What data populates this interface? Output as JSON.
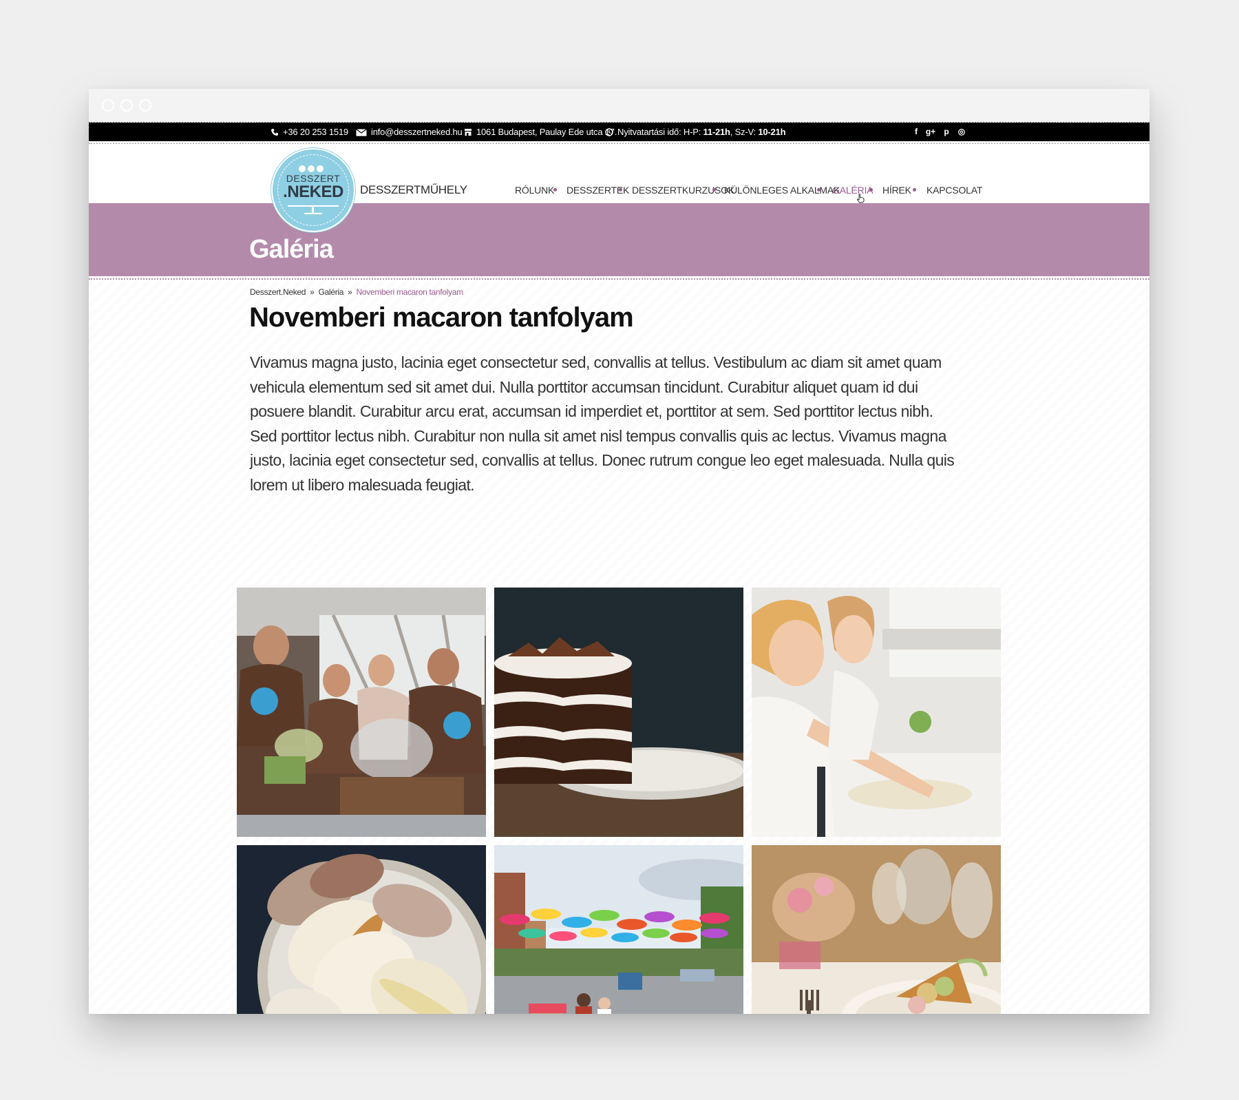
{
  "topbar": {
    "phone": "+36 20 253 1519",
    "email": "info@desszertneked.hu",
    "address": "1061 Budapest, Paulay Ede utca 17.",
    "hours_label": "Nyitvatartási idő: H-P: ",
    "hours_weekday": "11-21h",
    "hours_sep": ", Sz-V: ",
    "hours_weekend": "10-21h",
    "social": [
      "f",
      "g+",
      "p",
      "◎"
    ]
  },
  "logo": {
    "line1": "DESSZERT",
    "line2": ".NEKED"
  },
  "tagline": "DESSZERTMŰHELY",
  "nav": [
    "RÓLUNK",
    "DESSZERTEK",
    "DESSZERTKURZUSOK",
    "KÜLÖNLEGES ALKALMAK",
    "GALÉRIA",
    "HÍREK",
    "KAPCSOLAT"
  ],
  "banner": {
    "title": "Galéria"
  },
  "breadcrumb": {
    "home": "Desszert.Neked",
    "section": "Galéria",
    "current": "Novemberi macaron tanfolyam",
    "sep": "»"
  },
  "page": {
    "title": "Novemberi macaron tanfolyam",
    "description": "Vivamus magna justo, lacinia eget consectetur sed, convallis at tellus. Vestibulum ac diam sit amet quam vehicula elementum sed sit amet dui. Nulla porttitor accumsan tincidunt. Curabitur aliquet quam id dui posuere blandit. Curabitur arcu erat, accumsan id imperdiet et, porttitor at sem. Sed porttitor lectus nibh. Sed porttitor lectus nibh. Curabitur non nulla sit amet nisl tempus convallis quis ac lectus. Vivamus magna justo, lacinia eget consectetur sed, convallis at tellus. Donec rutrum congue leo eget malesuada. Nulla quis lorem ut libero malesuada feugiat."
  },
  "colors": {
    "accent": "#9b5b8f",
    "banner": "#b48aab",
    "logo": "#8fcfe3",
    "topbar": "#000000"
  }
}
